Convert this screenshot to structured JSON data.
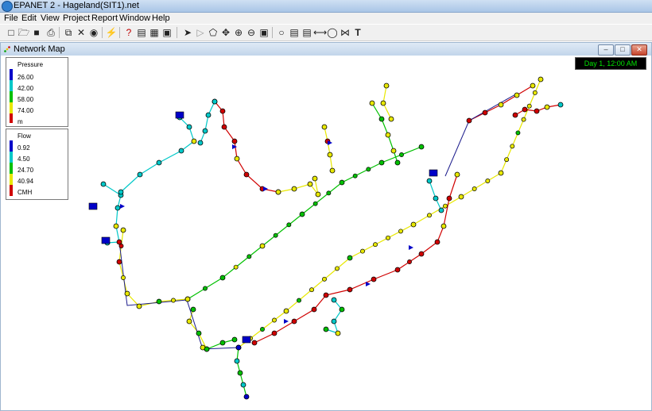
{
  "window": {
    "title": "EPANET 2 - Hageland(SIT1).net"
  },
  "menu": [
    "File",
    "Edit",
    "View",
    "Project",
    "Report",
    "Window",
    "Help"
  ],
  "toolbar": {
    "icons": [
      "new-file-icon",
      "open-folder-icon",
      "save-icon",
      "print-icon",
      "copy-icon",
      "delete-icon",
      "find-icon",
      "run-analysis-icon",
      "query-icon",
      "graph-icon",
      "table-icon",
      "options-icon",
      "select-object-icon",
      "select-vertex-icon",
      "select-region-icon",
      "pan-icon",
      "zoom-in-icon",
      "zoom-out-icon",
      "full-extent-icon",
      "junction-icon",
      "reservoir-icon",
      "tank-icon",
      "pipe-icon",
      "pump-icon",
      "valve-icon",
      "label-icon"
    ]
  },
  "document": {
    "title": "Network Map"
  },
  "legend_pressure": {
    "title": "Pressure",
    "values": [
      "26.00",
      "42.00",
      "58.00",
      "74.00"
    ],
    "unit": "m",
    "colors": [
      "#0000c8",
      "#00c8c8",
      "#00c000",
      "#e8e800",
      "#d00000"
    ]
  },
  "legend_flow": {
    "title": "Flow",
    "values": [
      "0.92",
      "4.50",
      "24.70",
      "40.94"
    ],
    "unit": "CMH",
    "colors": [
      "#0000c8",
      "#00c8c8",
      "#00c000",
      "#e8e800",
      "#d00000"
    ]
  },
  "clock": {
    "text": "Day 1, 12:00 AM",
    "color": "#00e600"
  }
}
